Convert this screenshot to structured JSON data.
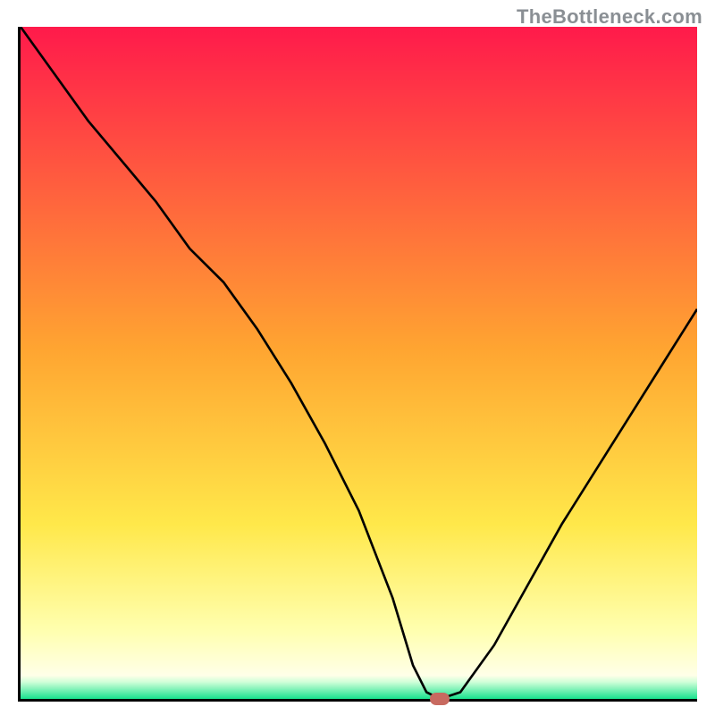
{
  "watermark": "TheBottleneck.com",
  "colors": {
    "top": "#ff1a4b",
    "mid_orange": "#ffa531",
    "yellow": "#ffe84a",
    "pale_yellow": "#ffffb0",
    "green": "#18e28e",
    "curve": "#000000",
    "marker": "#c86a60",
    "axis": "#000000"
  },
  "chart_data": {
    "type": "line",
    "title": "",
    "xlabel": "",
    "ylabel": "",
    "xlim": [
      0,
      100
    ],
    "ylim": [
      0,
      100
    ],
    "x": [
      0,
      5,
      10,
      15,
      20,
      25,
      30,
      35,
      40,
      45,
      50,
      55,
      58,
      60,
      62,
      65,
      70,
      75,
      80,
      85,
      90,
      95,
      100
    ],
    "values": [
      100,
      93,
      86,
      80,
      74,
      67,
      62,
      55,
      47,
      38,
      28,
      15,
      5,
      1,
      0,
      1,
      8,
      17,
      26,
      34,
      42,
      50,
      58
    ],
    "marker": {
      "x": 62,
      "y": 0
    },
    "gradient_bands": [
      {
        "stop": 0.0,
        "color": "#ff1a4b"
      },
      {
        "stop": 0.48,
        "color": "#ffa531"
      },
      {
        "stop": 0.74,
        "color": "#ffe84a"
      },
      {
        "stop": 0.9,
        "color": "#ffffb0"
      },
      {
        "stop": 0.965,
        "color": "#ffffe8"
      },
      {
        "stop": 0.975,
        "color": "#cfffd8"
      },
      {
        "stop": 1.0,
        "color": "#18e28e"
      }
    ]
  }
}
